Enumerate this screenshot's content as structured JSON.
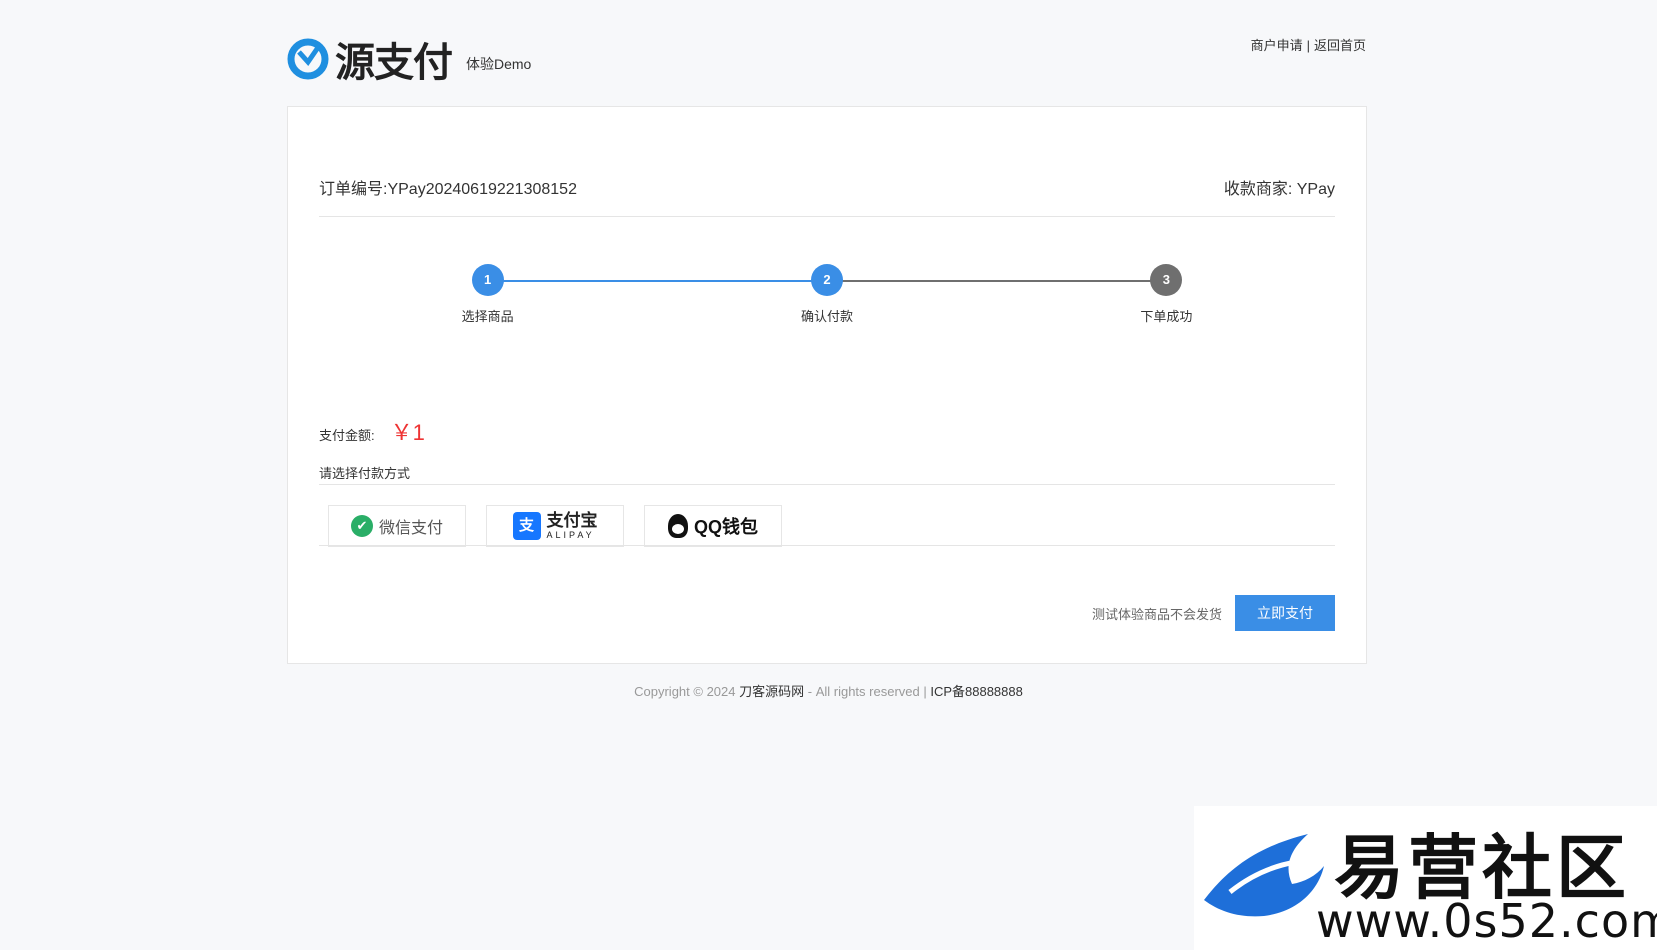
{
  "header": {
    "logo_text": "源支付",
    "demo_label": "体验Demo",
    "links": [
      "商户申请",
      "返回首页"
    ],
    "separator": "|"
  },
  "order": {
    "number_label": "订单编号:YPay20240619221308152",
    "merchant_label": "收款商家: YPay"
  },
  "steps": [
    {
      "num": "1",
      "label": "选择商品",
      "status": "done"
    },
    {
      "num": "2",
      "label": "确认付款",
      "status": "active"
    },
    {
      "num": "3",
      "label": "下单成功",
      "status": "pending"
    }
  ],
  "colors": {
    "active": "#3a8ee6",
    "pending": "#6f6f6f",
    "price": "#e33333",
    "button": "#3a8ee6"
  },
  "payment": {
    "amount_label": "支付金额:",
    "amount_value": "￥1",
    "choose_label": "请选择付款方式",
    "options": [
      {
        "name": "微信支付",
        "icon": "wechat-pay-icon"
      },
      {
        "name": "支付宝",
        "sub": "ALIPAY",
        "icon": "alipay-icon"
      },
      {
        "name": "QQ钱包",
        "icon": "qq-wallet-icon"
      }
    ]
  },
  "action": {
    "note": "测试体验商品不会发货",
    "pay_button": "立即支付"
  },
  "footer": {
    "copyright": "Copyright © 2024",
    "site": "刀客源码网",
    "rights": "- All rights reserved |",
    "icp": "ICP备88888888"
  },
  "watermark": {
    "title": "易营社区",
    "url": "www.0s52.com"
  }
}
